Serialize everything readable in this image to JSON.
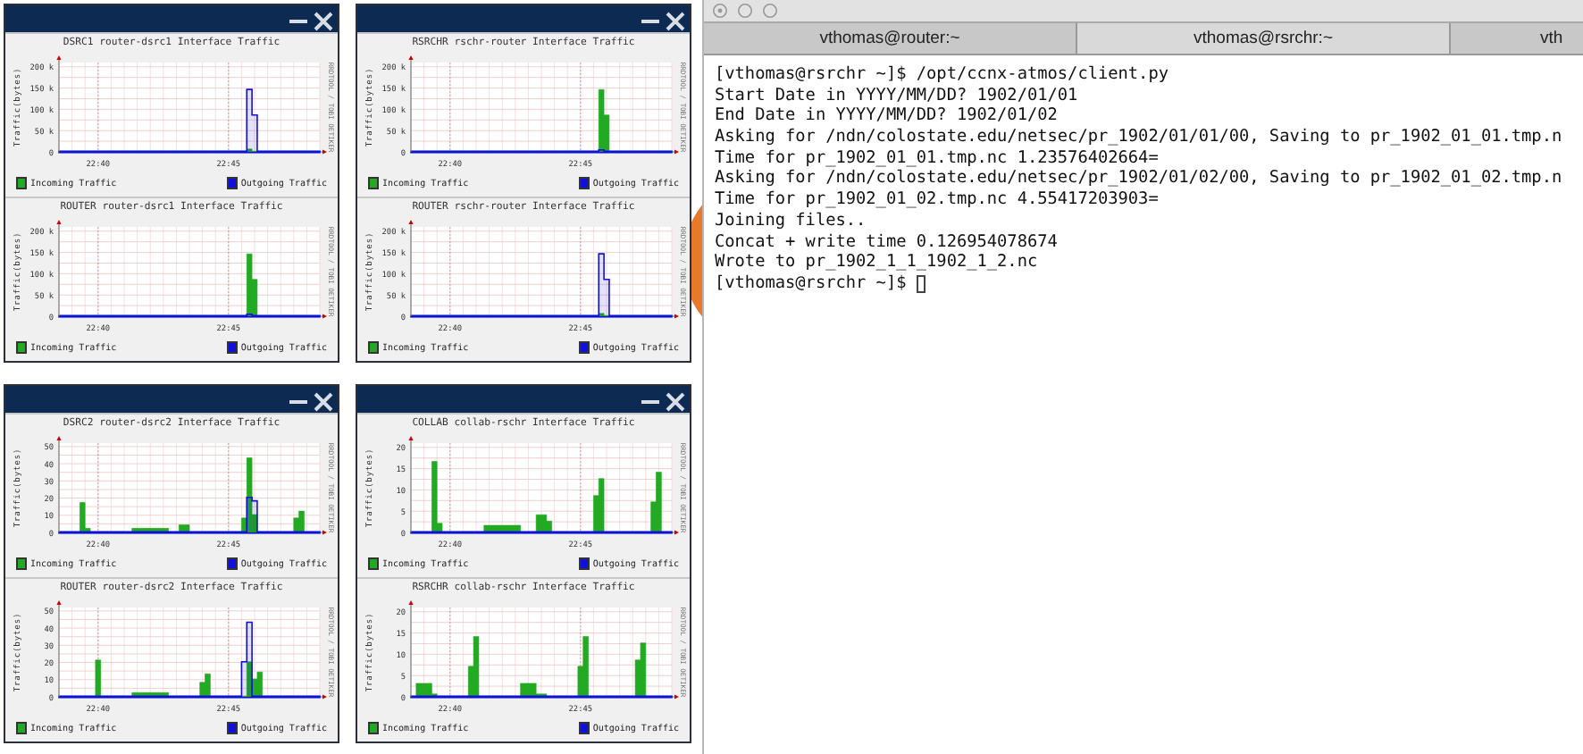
{
  "windows": [
    {
      "charts": [
        {
          "side_text": "RRDTOOL / TOBI OETIKER",
          "chart_data": {
            "type": "area",
            "grid": true,
            "legend": "bottom",
            "title": "DSRC1 router-dsrc1 Interface Traffic",
            "ylabel": "Traffic(bytes)",
            "ylim": [
              0,
              210000
            ],
            "yticks": [
              0,
              {
                "value": 50000,
                "label": "50 k"
              },
              {
                "value": 100000,
                "label": "100 k"
              },
              {
                "value": 150000,
                "label": "150 k"
              },
              {
                "value": 200000,
                "label": "200 k"
              }
            ],
            "categories": [
              null,
              null,
              null,
              null,
              null,
              null,
              null,
              "22:40",
              null,
              null,
              null,
              null,
              null,
              null,
              null,
              null,
              null,
              null,
              null,
              null,
              null,
              null,
              null,
              null,
              null,
              null,
              null,
              null,
              null,
              null,
              null,
              null,
              "22:45",
              null,
              null,
              null,
              null,
              null,
              null,
              null,
              null,
              null,
              null,
              null,
              null,
              null,
              null,
              null,
              null,
              null
            ],
            "series": [
              {
                "name": "Incoming Traffic",
                "color": "#22aa22",
                "values": [
                  0,
                  0,
                  0,
                  0,
                  0,
                  0,
                  0,
                  0,
                  0,
                  0,
                  0,
                  0,
                  0,
                  0,
                  0,
                  0,
                  0,
                  0,
                  0,
                  0,
                  0,
                  0,
                  0,
                  0,
                  0,
                  0,
                  0,
                  0,
                  0,
                  0,
                  0,
                  0,
                  0,
                  0,
                  0,
                  0,
                  5000,
                  0,
                  0,
                  0,
                  0,
                  0,
                  0,
                  0,
                  0,
                  0,
                  0,
                  0,
                  0,
                  0
                ]
              },
              {
                "name": "Outgoing Traffic",
                "color": "#1010dd",
                "values": [
                  0,
                  0,
                  0,
                  0,
                  0,
                  0,
                  0,
                  0,
                  0,
                  0,
                  0,
                  0,
                  0,
                  0,
                  0,
                  0,
                  0,
                  0,
                  0,
                  0,
                  0,
                  0,
                  0,
                  0,
                  0,
                  0,
                  0,
                  0,
                  0,
                  0,
                  0,
                  0,
                  0,
                  0,
                  0,
                  0,
                  145000,
                  85000,
                  0,
                  0,
                  0,
                  0,
                  0,
                  0,
                  0,
                  0,
                  0,
                  0,
                  0,
                  0
                ]
              }
            ]
          }
        },
        {
          "side_text": "RRDTOOL / TOBI OETIKER",
          "chart_data": {
            "type": "area",
            "grid": true,
            "legend": "bottom",
            "title": "ROUTER router-dsrc1 Interface Traffic",
            "ylabel": "Traffic(bytes)",
            "ylim": [
              0,
              210000
            ],
            "yticks": [
              0,
              {
                "value": 50000,
                "label": "50 k"
              },
              {
                "value": 100000,
                "label": "100 k"
              },
              {
                "value": 150000,
                "label": "150 k"
              },
              {
                "value": 200000,
                "label": "200 k"
              }
            ],
            "categories": [
              null,
              null,
              null,
              null,
              null,
              null,
              null,
              "22:40",
              null,
              null,
              null,
              null,
              null,
              null,
              null,
              null,
              null,
              null,
              null,
              null,
              null,
              null,
              null,
              null,
              null,
              null,
              null,
              null,
              null,
              null,
              null,
              null,
              "22:45",
              null,
              null,
              null,
              null,
              null,
              null,
              null,
              null,
              null,
              null,
              null,
              null,
              null,
              null,
              null,
              null,
              null
            ],
            "series": [
              {
                "name": "Incoming Traffic",
                "color": "#22aa22",
                "values": [
                  0,
                  0,
                  0,
                  0,
                  0,
                  0,
                  0,
                  0,
                  0,
                  0,
                  0,
                  0,
                  0,
                  0,
                  0,
                  0,
                  0,
                  0,
                  0,
                  0,
                  0,
                  0,
                  0,
                  0,
                  0,
                  0,
                  0,
                  0,
                  0,
                  0,
                  0,
                  0,
                  0,
                  0,
                  0,
                  0,
                  145000,
                  85000,
                  0,
                  0,
                  0,
                  0,
                  0,
                  0,
                  0,
                  0,
                  0,
                  0,
                  0,
                  0
                ]
              },
              {
                "name": "Outgoing Traffic",
                "color": "#1010dd",
                "values": [
                  0,
                  0,
                  0,
                  0,
                  0,
                  0,
                  0,
                  0,
                  0,
                  0,
                  0,
                  0,
                  0,
                  0,
                  0,
                  0,
                  0,
                  0,
                  0,
                  0,
                  0,
                  0,
                  0,
                  0,
                  0,
                  0,
                  0,
                  0,
                  0,
                  0,
                  0,
                  0,
                  0,
                  0,
                  0,
                  0,
                  3000,
                  0,
                  0,
                  0,
                  0,
                  0,
                  0,
                  0,
                  0,
                  0,
                  0,
                  0,
                  0,
                  0
                ]
              }
            ]
          }
        }
      ]
    },
    {
      "charts": [
        {
          "side_text": "RRDTOOL / TOBI OETIKER",
          "chart_data": {
            "type": "area",
            "grid": true,
            "legend": "bottom",
            "title": "RSRCHR rschr-router Interface Traffic",
            "ylabel": "Traffic(bytes)",
            "ylim": [
              0,
              210000
            ],
            "yticks": [
              0,
              {
                "value": 50000,
                "label": "50 k"
              },
              {
                "value": 100000,
                "label": "100 k"
              },
              {
                "value": 150000,
                "label": "150 k"
              },
              {
                "value": 200000,
                "label": "200 k"
              }
            ],
            "categories": [
              null,
              null,
              null,
              null,
              null,
              null,
              null,
              "22:40",
              null,
              null,
              null,
              null,
              null,
              null,
              null,
              null,
              null,
              null,
              null,
              null,
              null,
              null,
              null,
              null,
              null,
              null,
              null,
              null,
              null,
              null,
              null,
              null,
              "22:45",
              null,
              null,
              null,
              null,
              null,
              null,
              null,
              null,
              null,
              null,
              null,
              null,
              null,
              null,
              null,
              null,
              null
            ],
            "series": [
              {
                "name": "Incoming Traffic",
                "color": "#22aa22",
                "values": [
                  0,
                  0,
                  0,
                  0,
                  0,
                  0,
                  0,
                  0,
                  0,
                  0,
                  0,
                  0,
                  0,
                  0,
                  0,
                  0,
                  0,
                  0,
                  0,
                  0,
                  0,
                  0,
                  0,
                  0,
                  0,
                  0,
                  0,
                  0,
                  0,
                  0,
                  0,
                  0,
                  0,
                  0,
                  0,
                  0,
                  145000,
                  85000,
                  0,
                  0,
                  0,
                  0,
                  0,
                  0,
                  0,
                  0,
                  0,
                  0,
                  0,
                  0
                ]
              },
              {
                "name": "Outgoing Traffic",
                "color": "#1010dd",
                "values": [
                  0,
                  0,
                  0,
                  0,
                  0,
                  0,
                  0,
                  0,
                  0,
                  0,
                  0,
                  0,
                  0,
                  0,
                  0,
                  0,
                  0,
                  0,
                  0,
                  0,
                  0,
                  0,
                  0,
                  0,
                  0,
                  0,
                  0,
                  0,
                  0,
                  0,
                  0,
                  0,
                  0,
                  0,
                  0,
                  0,
                  3000,
                  0,
                  0,
                  0,
                  0,
                  0,
                  0,
                  0,
                  0,
                  0,
                  0,
                  0,
                  0,
                  0
                ]
              }
            ]
          }
        },
        {
          "side_text": "RRDTOOL / TOBI OETIKER",
          "chart_data": {
            "type": "area",
            "grid": true,
            "legend": "bottom",
            "title": "ROUTER rschr-router Interface Traffic",
            "ylabel": "Traffic(bytes)",
            "ylim": [
              0,
              210000
            ],
            "yticks": [
              0,
              {
                "value": 50000,
                "label": "50 k"
              },
              {
                "value": 100000,
                "label": "100 k"
              },
              {
                "value": 150000,
                "label": "150 k"
              },
              {
                "value": 200000,
                "label": "200 k"
              }
            ],
            "categories": [
              null,
              null,
              null,
              null,
              null,
              null,
              null,
              "22:40",
              null,
              null,
              null,
              null,
              null,
              null,
              null,
              null,
              null,
              null,
              null,
              null,
              null,
              null,
              null,
              null,
              null,
              null,
              null,
              null,
              null,
              null,
              null,
              null,
              "22:45",
              null,
              null,
              null,
              null,
              null,
              null,
              null,
              null,
              null,
              null,
              null,
              null,
              null,
              null,
              null,
              null,
              null
            ],
            "series": [
              {
                "name": "Incoming Traffic",
                "color": "#22aa22",
                "values": [
                  0,
                  0,
                  0,
                  0,
                  0,
                  0,
                  0,
                  0,
                  0,
                  0,
                  0,
                  0,
                  0,
                  0,
                  0,
                  0,
                  0,
                  0,
                  0,
                  0,
                  0,
                  0,
                  0,
                  0,
                  0,
                  0,
                  0,
                  0,
                  0,
                  0,
                  0,
                  0,
                  0,
                  0,
                  0,
                  0,
                  5000,
                  0,
                  0,
                  0,
                  0,
                  0,
                  0,
                  0,
                  0,
                  0,
                  0,
                  0,
                  0,
                  0
                ]
              },
              {
                "name": "Outgoing Traffic",
                "color": "#1010dd",
                "values": [
                  0,
                  0,
                  0,
                  0,
                  0,
                  0,
                  0,
                  0,
                  0,
                  0,
                  0,
                  0,
                  0,
                  0,
                  0,
                  0,
                  0,
                  0,
                  0,
                  0,
                  0,
                  0,
                  0,
                  0,
                  0,
                  0,
                  0,
                  0,
                  0,
                  0,
                  0,
                  0,
                  0,
                  0,
                  0,
                  0,
                  145000,
                  85000,
                  0,
                  0,
                  0,
                  0,
                  0,
                  0,
                  0,
                  0,
                  0,
                  0,
                  0,
                  0
                ]
              }
            ]
          }
        }
      ]
    },
    {
      "charts": [
        {
          "side_text": "RRDTOOL / TOBI OETIKER",
          "chart_data": {
            "type": "area",
            "grid": true,
            "legend": "bottom",
            "title": "DSRC2 router-dsrc2 Interface Traffic",
            "ylabel": "Traffic(bytes)",
            "ylim": [
              0,
              52
            ],
            "yticks": [
              0,
              10,
              20,
              30,
              40,
              50
            ],
            "categories": [
              null,
              null,
              null,
              null,
              null,
              null,
              null,
              "22:40",
              null,
              null,
              null,
              null,
              null,
              null,
              null,
              null,
              null,
              null,
              null,
              null,
              null,
              null,
              null,
              null,
              null,
              null,
              null,
              null,
              null,
              null,
              null,
              null,
              "22:45",
              null,
              null,
              null,
              null,
              null,
              null,
              null,
              null,
              null,
              null,
              null,
              null,
              null,
              null,
              null,
              null,
              null
            ],
            "series": [
              {
                "name": "Incoming Traffic",
                "color": "#22aa22",
                "values": [
                  0,
                  0,
                  0,
                  0,
                  17,
                  2,
                  0,
                  0,
                  0,
                  0,
                  0,
                  0,
                  0,
                  0,
                  2,
                  2,
                  2,
                  2,
                  2,
                  2,
                  2,
                  0,
                  0,
                  4,
                  4,
                  0,
                  0,
                  0,
                  0,
                  0,
                  0,
                  0,
                  0,
                  0,
                  0,
                  8,
                  43,
                  10,
                  0,
                  0,
                  0,
                  0,
                  0,
                  0,
                  0,
                  8,
                  12,
                  0,
                  0,
                  0
                ]
              },
              {
                "name": "Outgoing Traffic",
                "color": "#1010dd",
                "values": [
                  0,
                  0,
                  0,
                  0,
                  0,
                  0,
                  0,
                  0,
                  0,
                  0,
                  0,
                  0,
                  0,
                  0,
                  0,
                  0,
                  0,
                  0,
                  0,
                  0,
                  0,
                  0,
                  0,
                  0,
                  0,
                  0,
                  0,
                  0,
                  0,
                  0,
                  0,
                  0,
                  0,
                  0,
                  0,
                  0,
                  20,
                  18,
                  0,
                  0,
                  0,
                  0,
                  0,
                  0,
                  0,
                  0,
                  0,
                  0,
                  0,
                  0
                ]
              }
            ]
          }
        },
        {
          "side_text": "RRDTOOL / TOBI OETIKER",
          "chart_data": {
            "type": "area",
            "grid": true,
            "legend": "bottom",
            "title": "ROUTER router-dsrc2 Interface Traffic",
            "ylabel": "Traffic(bytes)",
            "ylim": [
              0,
              52
            ],
            "yticks": [
              0,
              10,
              20,
              30,
              40,
              50
            ],
            "categories": [
              null,
              null,
              null,
              null,
              null,
              null,
              null,
              "22:40",
              null,
              null,
              null,
              null,
              null,
              null,
              null,
              null,
              null,
              null,
              null,
              null,
              null,
              null,
              null,
              null,
              null,
              null,
              null,
              null,
              null,
              null,
              null,
              null,
              "22:45",
              null,
              null,
              null,
              null,
              null,
              null,
              null,
              null,
              null,
              null,
              null,
              null,
              null,
              null,
              null,
              null,
              null
            ],
            "series": [
              {
                "name": "Incoming Traffic",
                "color": "#22aa22",
                "values": [
                  0,
                  0,
                  0,
                  0,
                  0,
                  0,
                  0,
                  21,
                  0,
                  0,
                  0,
                  0,
                  0,
                  0,
                  2,
                  2,
                  2,
                  2,
                  2,
                  2,
                  2,
                  0,
                  0,
                  0,
                  0,
                  0,
                  0,
                  8,
                  13,
                  0,
                  0,
                  0,
                  0,
                  0,
                  0,
                  0,
                  20,
                  10,
                  14,
                  0,
                  0,
                  0,
                  0,
                  0,
                  0,
                  0,
                  0,
                  0,
                  0,
                  0
                ]
              },
              {
                "name": "Outgoing Traffic",
                "color": "#1010dd",
                "values": [
                  0,
                  0,
                  0,
                  0,
                  0,
                  0,
                  0,
                  0,
                  0,
                  0,
                  0,
                  0,
                  0,
                  0,
                  0,
                  0,
                  0,
                  0,
                  0,
                  0,
                  0,
                  0,
                  0,
                  0,
                  0,
                  0,
                  0,
                  0,
                  0,
                  0,
                  0,
                  0,
                  0,
                  0,
                  0,
                  20,
                  43,
                  0,
                  0,
                  0,
                  0,
                  0,
                  0,
                  0,
                  0,
                  0,
                  0,
                  0,
                  0,
                  0
                ]
              }
            ]
          }
        }
      ]
    },
    {
      "charts": [
        {
          "side_text": "RRDTOOL / TOBI OETIKER",
          "chart_data": {
            "type": "area",
            "grid": true,
            "legend": "bottom",
            "title": "COLLAB collab-rschr Interface Traffic",
            "ylabel": "Traffic(bytes)",
            "ylim": [
              0,
              21
            ],
            "yticks": [
              0,
              5,
              10,
              15,
              20
            ],
            "categories": [
              null,
              null,
              null,
              null,
              null,
              null,
              null,
              "22:40",
              null,
              null,
              null,
              null,
              null,
              null,
              null,
              null,
              null,
              null,
              null,
              null,
              null,
              null,
              null,
              null,
              null,
              null,
              null,
              null,
              null,
              null,
              null,
              null,
              "22:45",
              null,
              null,
              null,
              null,
              null,
              null,
              null,
              null,
              null,
              null,
              null,
              null,
              null,
              null,
              null,
              null,
              null
            ],
            "series": [
              {
                "name": "Incoming Traffic",
                "color": "#22aa22",
                "values": [
                  0,
                  0,
                  0,
                  0,
                  16.5,
                  2,
                  0,
                  0,
                  0,
                  0,
                  0,
                  0,
                  0,
                  0,
                  1.5,
                  1.5,
                  1.5,
                  1.5,
                  1.5,
                  1.5,
                  1.5,
                  0,
                  0,
                  0,
                  4,
                  4,
                  2.5,
                  0,
                  0,
                  0,
                  0,
                  0,
                  0,
                  0,
                  0,
                  8.5,
                  12.5,
                  0,
                  0,
                  0,
                  0,
                  0,
                  0,
                  0,
                  0,
                  0,
                  7,
                  14,
                  0,
                  0
                ]
              },
              {
                "name": "Outgoing Traffic",
                "color": "#1010dd",
                "values": [
                  0,
                  0,
                  0,
                  0,
                  0,
                  0,
                  0,
                  0,
                  0,
                  0,
                  0,
                  0,
                  0,
                  0,
                  0,
                  0,
                  0,
                  0,
                  0,
                  0,
                  0,
                  0,
                  0,
                  0,
                  0,
                  0,
                  0,
                  0,
                  0,
                  0,
                  0,
                  0,
                  0,
                  0,
                  0,
                  0,
                  0,
                  0,
                  0,
                  0,
                  0,
                  0,
                  0,
                  0,
                  0,
                  0,
                  0,
                  0,
                  0,
                  0
                ]
              }
            ]
          }
        },
        {
          "side_text": "RRDTOOL / TOBI OETIKER",
          "chart_data": {
            "type": "area",
            "grid": true,
            "legend": "bottom",
            "title": "RSRCHR collab-rschr Interface Traffic",
            "ylabel": "Traffic(bytes)",
            "ylim": [
              0,
              21
            ],
            "yticks": [
              0,
              5,
              10,
              15,
              20
            ],
            "categories": [
              null,
              null,
              null,
              null,
              null,
              null,
              null,
              "22:40",
              null,
              null,
              null,
              null,
              null,
              null,
              null,
              null,
              null,
              null,
              null,
              null,
              null,
              null,
              null,
              null,
              null,
              null,
              null,
              null,
              null,
              null,
              null,
              null,
              "22:45",
              null,
              null,
              null,
              null,
              null,
              null,
              null,
              null,
              null,
              null,
              null,
              null,
              null,
              null,
              null,
              null,
              null
            ],
            "series": [
              {
                "name": "Incoming Traffic",
                "color": "#22aa22",
                "values": [
                  0,
                  3,
                  3,
                  3,
                  0.5,
                  0,
                  0,
                  0,
                  0,
                  0,
                  0,
                  7,
                  14,
                  0,
                  0,
                  0,
                  0,
                  0,
                  0,
                  0,
                  0,
                  3,
                  3,
                  3,
                  0.5,
                  0.5,
                  0,
                  0,
                  0,
                  0,
                  0,
                  0,
                  7,
                  14,
                  0,
                  0,
                  0,
                  0,
                  0,
                  0,
                  0,
                  0,
                  0,
                  8.5,
                  12.5,
                  0,
                  0,
                  0,
                  0,
                  0
                ]
              },
              {
                "name": "Outgoing Traffic",
                "color": "#1010dd",
                "values": [
                  0,
                  0,
                  0,
                  0,
                  0,
                  0,
                  0,
                  0,
                  0,
                  0,
                  0,
                  0,
                  0,
                  0,
                  0,
                  0,
                  0,
                  0,
                  0,
                  0,
                  0,
                  0,
                  0,
                  0,
                  0,
                  0,
                  0,
                  0,
                  0,
                  0,
                  0,
                  0,
                  0,
                  0,
                  0,
                  0,
                  0,
                  0,
                  0,
                  0,
                  0,
                  0,
                  0,
                  0,
                  0,
                  0,
                  0,
                  0,
                  0,
                  0
                ]
              }
            ]
          }
        }
      ]
    }
  ],
  "terminal": {
    "tabs": [
      {
        "label": "vthomas@router:~",
        "selected": false
      },
      {
        "label": "vthomas@rsrchr:~",
        "selected": true
      },
      {
        "label": "vth",
        "selected": false
      }
    ],
    "lines": [
      "[vthomas@rsrchr ~]$ /opt/ccnx-atmos/client.py",
      "Start Date in YYYY/MM/DD? 1902/01/01",
      "End Date in YYYY/MM/DD? 1902/01/02",
      "Asking for /ndn/colostate.edu/netsec/pr_1902/01/01/00, Saving to pr_1902_01_01.tmp.n",
      "Time for pr_1902_01_01.tmp.nc 1.23576402664=",
      "Asking for /ndn/colostate.edu/netsec/pr_1902/01/02/00, Saving to pr_1902_01_02.tmp.n",
      "Time for pr_1902_01_02.tmp.nc 4.55417203903=",
      "Joining files..",
      "Concat + write time 0.126954078674",
      "Wrote to pr_1902_1_1_1902_1_2.nc",
      "[vthomas@rsrchr ~]$ "
    ]
  }
}
